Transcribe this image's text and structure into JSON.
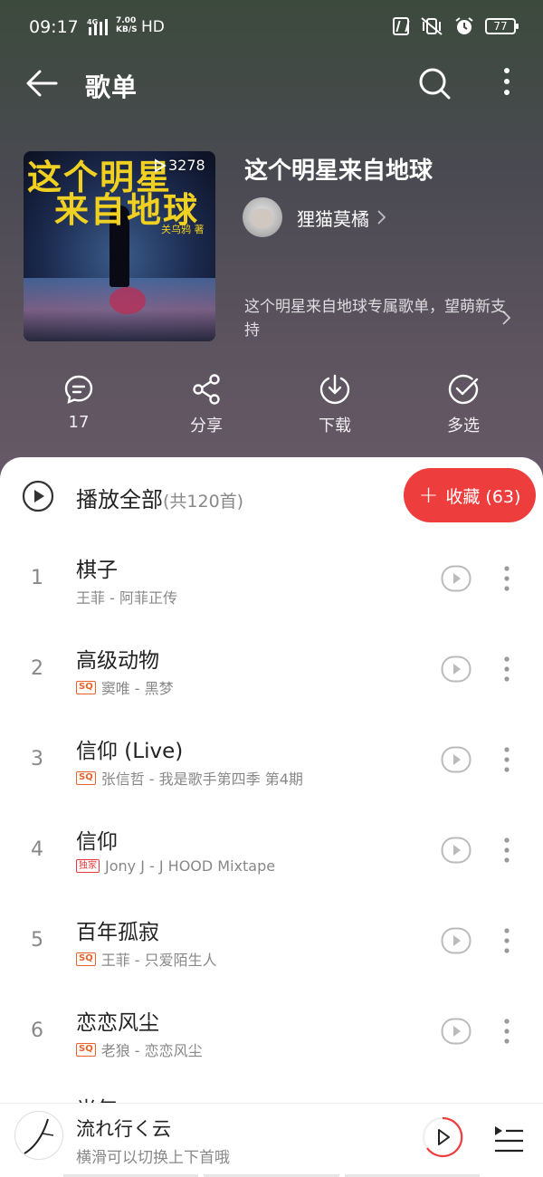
{
  "status_bar": {
    "time": "09:17",
    "network": "4G",
    "speed_value": "7.00",
    "speed_unit": "KB/S",
    "hd": "HD",
    "battery": "77"
  },
  "nav": {
    "title": "歌单",
    "back_icon": "arrow-left-icon",
    "search_icon": "search-icon",
    "more_icon": "more-vertical-icon"
  },
  "playlist": {
    "cover_line1": "这个明星",
    "cover_line2": "来自地球",
    "cover_author": "关乌鸦 著",
    "play_count": "3278",
    "title": "这个明星来自地球",
    "creator": "狸猫莫橘",
    "description": "这个明星来自地球专属歌单，望萌新支持"
  },
  "actions": [
    {
      "label": "17",
      "icon": "comment-icon"
    },
    {
      "label": "分享",
      "icon": "share-icon"
    },
    {
      "label": "下载",
      "icon": "download-icon"
    },
    {
      "label": "多选",
      "icon": "multi-select-icon"
    }
  ],
  "play_all": {
    "label": "播放全部",
    "count": "(共120首)",
    "collect_label": "收藏 (63)"
  },
  "songs": [
    {
      "index": "1",
      "title": "棋子",
      "badge": "",
      "meta": "王菲 - 阿菲正传"
    },
    {
      "index": "2",
      "title": "高级动物",
      "badge": "SQ",
      "meta": "窦唯 - 黑梦"
    },
    {
      "index": "3",
      "title": "信仰 (Live)",
      "badge": "SQ",
      "meta": "张信哲 - 我是歌手第四季 第4期"
    },
    {
      "index": "4",
      "title": "信仰",
      "badge": "独家",
      "meta": "Jony J - J HOOD Mixtape"
    },
    {
      "index": "5",
      "title": "百年孤寂",
      "badge": "SQ",
      "meta": "王菲 - 只爱陌生人"
    },
    {
      "index": "6",
      "title": "恋恋风尘",
      "badge": "SQ",
      "meta": "老狼 - 恋恋风尘"
    }
  ],
  "partial_song": "光年",
  "mini_player": {
    "title": "流れ行く云",
    "subtitle": "横滑可以切换上下首哦"
  },
  "colors": {
    "accent": "#ee3d3d",
    "sq_badge": "#e8622c",
    "exclusive_badge": "#e53a3a"
  }
}
